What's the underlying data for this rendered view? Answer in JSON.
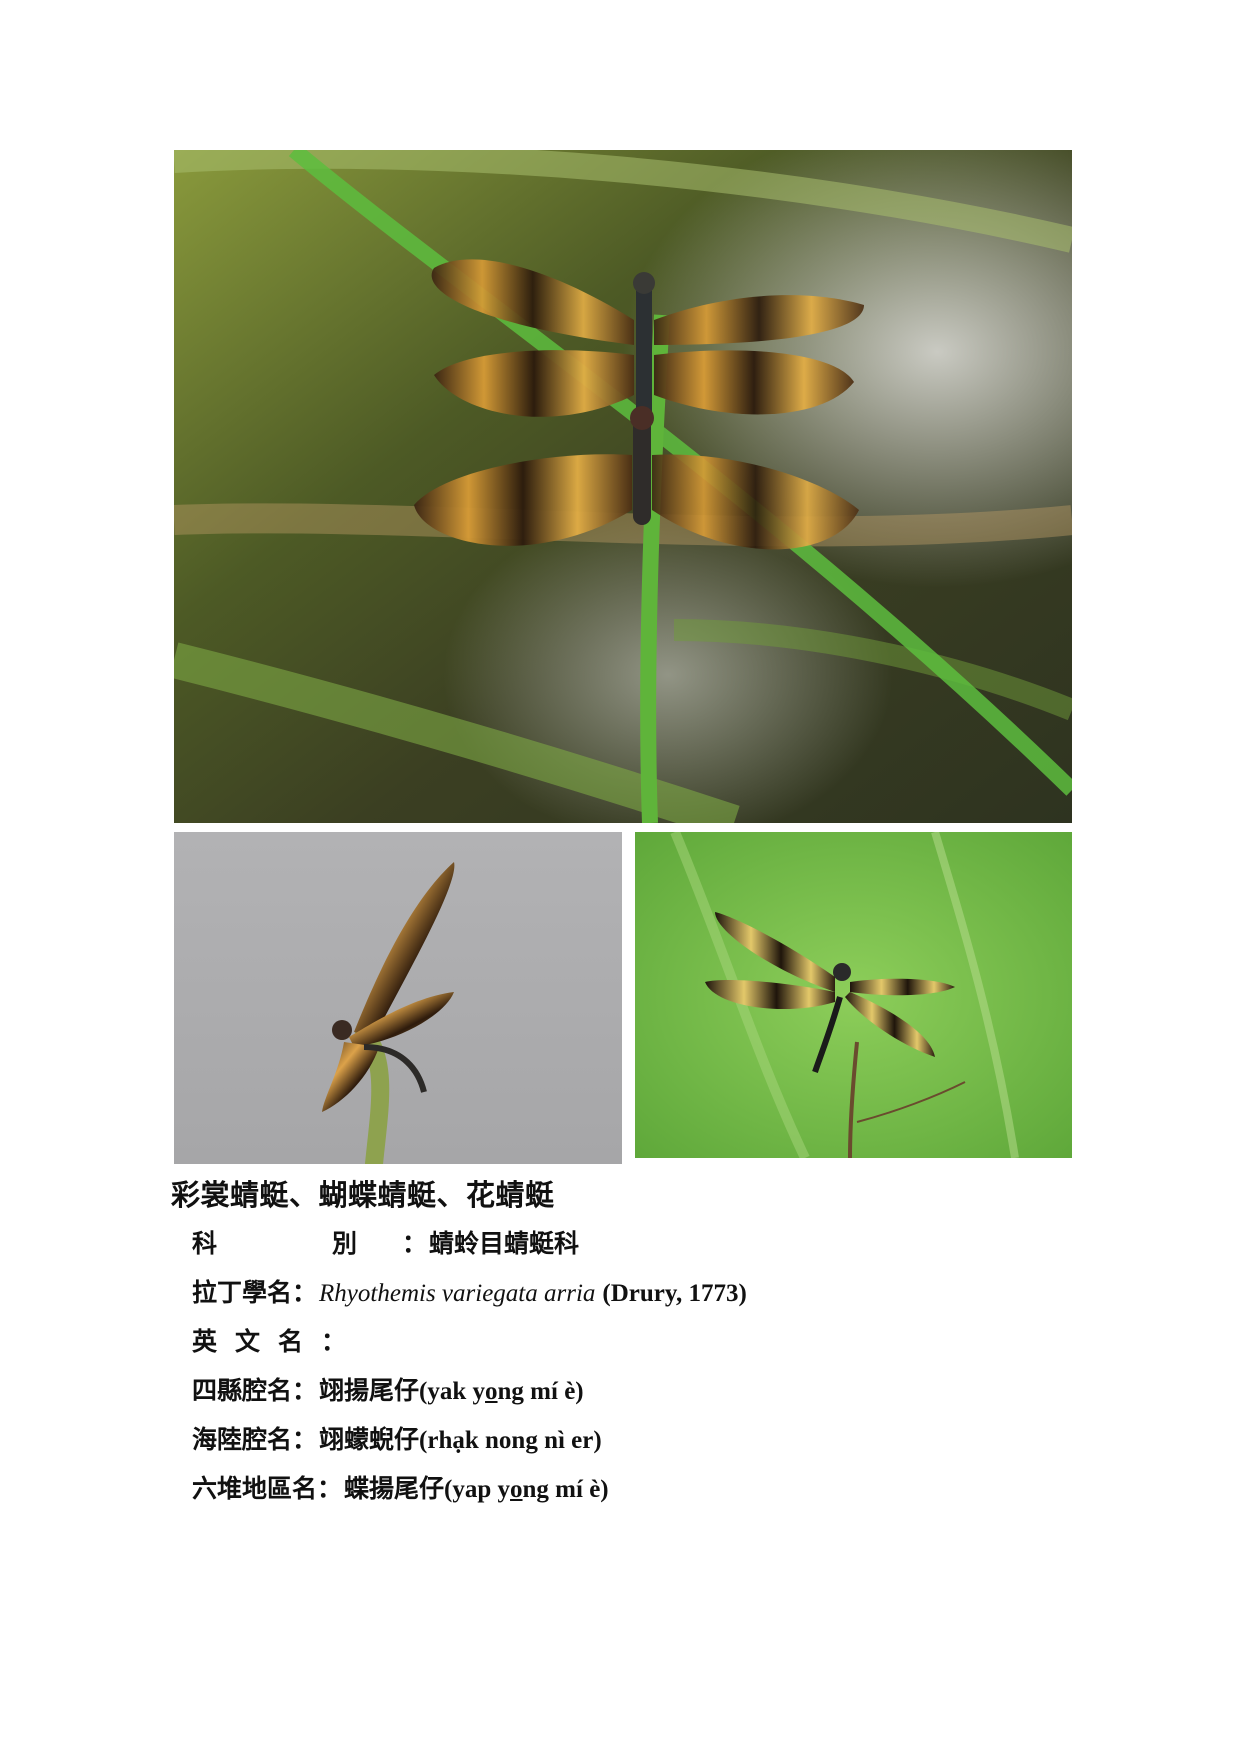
{
  "title": "彩裳蜻蜓、蝴蝶蜻蜓、花蜻蜓",
  "info": {
    "family": {
      "label": "科　別",
      "value": "蜻蛉目蜻蜓科"
    },
    "latin": {
      "label": "拉丁學名",
      "species": "Rhyothemis variegata arria",
      "author": "(Drury, 1773)"
    },
    "english": {
      "label": "英文名",
      "value": ""
    },
    "sixian": {
      "label": "四縣腔名",
      "value_cjk": "翊揚尾仔",
      "roman_open": "(yak y",
      "roman_ul": "o",
      "roman_close": "ng mí è)"
    },
    "hailu": {
      "label": "海陸腔名",
      "value_cjk": "翊蠓蜺仔",
      "roman": "(rhạk nong nì er)"
    },
    "liudui": {
      "label": "六堆地區名",
      "value_cjk": "蝶揚尾仔",
      "roman_open": "(yap y",
      "roman_ul": "o",
      "roman_close": "ng mí è)"
    }
  },
  "colors": {
    "wing_amber": "#e0a83a",
    "wing_dark": "#2a1a0e",
    "stem_green": "#5fb43a",
    "sky_gray": "#b9b9bb",
    "leaf_green": "#7fc150"
  }
}
